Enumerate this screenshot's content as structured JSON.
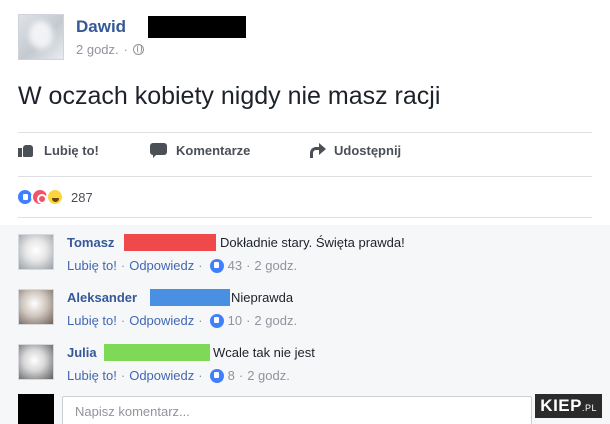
{
  "post": {
    "author": "Dawid",
    "time": "2 godz.",
    "dot": "·",
    "text": "W oczach kobiety nigdy nie masz racji"
  },
  "actions": {
    "like": "Lubię to!",
    "comment": "Komentarze",
    "share": "Udostępnij"
  },
  "reactions": {
    "count": "287",
    "types": [
      "like-icon",
      "love-icon",
      "haha-icon"
    ]
  },
  "comments": [
    {
      "name": "Tomasz",
      "text": "Dokładnie stary. Święta prawda!",
      "like": "Lubię to!",
      "reply": "Odpowiedz",
      "likes": "43",
      "time": "2 godz.",
      "redact_color": "#f0494b"
    },
    {
      "name": "Aleksander",
      "text": "Nieprawda",
      "like": "Lubię to!",
      "reply": "Odpowiedz",
      "likes": "10",
      "time": "2 godz.",
      "redact_color": "#4a90e2"
    },
    {
      "name": "Julia",
      "text": "Wcale tak nie jest",
      "like": "Lubię to!",
      "reply": "Odpowiedz",
      "likes": "8",
      "time": "2 godz.",
      "redact_color": "#7ed957"
    }
  ],
  "writer": {
    "placeholder": "Napisz komentarz..."
  },
  "watermark": {
    "brand": "KIEP",
    "suffix": ".PL"
  },
  "colors": {
    "link": "#365899",
    "meta": "#90949c",
    "like_blue": "#4080ff"
  }
}
